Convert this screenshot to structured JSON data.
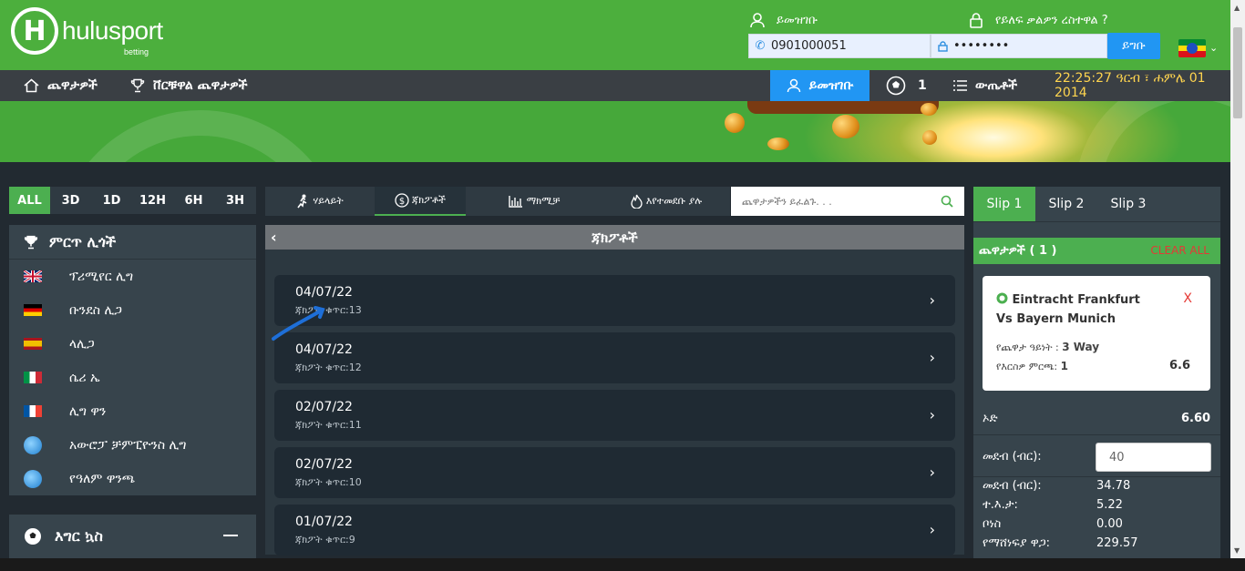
{
  "brand": {
    "logo_letter": "H",
    "name": "hulusport",
    "sub": "betting"
  },
  "header": {
    "register_link": "ይመዝገቡ",
    "forgot_link": "የይለፍ ቃልዎን ረስተዋል ?",
    "phone_value": "0901000051",
    "password_value": "••••••••",
    "login_button": "ይግቡ"
  },
  "nav": {
    "games": "ጨዋታዎች",
    "live_games": "ቨርቹዋል ጨዋታዎች",
    "register": "ይመዝገቡ",
    "ball_count": "1",
    "results": "ውጤቶች",
    "clock": "22:25:27 ዓርብ ፣ ሐምሌ 01 2014"
  },
  "time_filters": [
    "ALL",
    "3D",
    "1D",
    "12H",
    "6H",
    "3H"
  ],
  "leagues": {
    "title": "ምርጥ ሊጎች",
    "items": [
      {
        "name": "ፕሪሚየር ሊግ",
        "flag": "uk"
      },
      {
        "name": "ቡንደስ ሊጋ",
        "flag": "de"
      },
      {
        "name": "ላሊጋ",
        "flag": "es"
      },
      {
        "name": "ሴሪ ኤ",
        "flag": "it"
      },
      {
        "name": "ሊግ ዋን",
        "flag": "fr"
      },
      {
        "name": "አውሮፓ ቻምፒዮንስ ሊግ",
        "flag": "globe"
      },
      {
        "name": "የዓለም ዋንጫ",
        "flag": "globe"
      }
    ]
  },
  "sports": {
    "title": "እግር ኳስ"
  },
  "tabs": [
    "ሃይላይት",
    "ጃክፖቶች",
    "ማክሚቻ",
    "እየተመደቡ ያሉ"
  ],
  "search": {
    "placeholder": "ጨዋታዎችን ይፈልጉ. . ."
  },
  "jackpot": {
    "title": "ጃክፖቶች",
    "rows": [
      {
        "date": "04/07/22",
        "count": "ጃክፖት ቁጥር:13"
      },
      {
        "date": "04/07/22",
        "count": "ጃክፖት ቁጥር:12"
      },
      {
        "date": "02/07/22",
        "count": "ጃክፖት ቁጥር:11"
      },
      {
        "date": "02/07/22",
        "count": "ጃክፖት ቁጥር:10"
      },
      {
        "date": "01/07/22",
        "count": "ጃክፖት ቁጥር:9"
      }
    ]
  },
  "slip": {
    "tabs": [
      "Slip 1",
      "Slip 2",
      "Slip 3"
    ],
    "games_label": "ጨዋታዎች ( 1 )",
    "clear_all": "CLEAR ALL",
    "match": "Eintracht Frankfurt Vs Bayern Munich",
    "remove": "X",
    "market_label": "የጨዋታ ዓይነት :",
    "market_value": "3 Way",
    "pick_label": "የእርስዎ ምርጫ:",
    "pick_value": "1",
    "pick_odd": "6.6",
    "odd_label": "ኦድ",
    "odd_value": "6.60",
    "stake_label": "መደብ (ብር):",
    "stake_value": "40",
    "rows": [
      {
        "label": "መደብ (ብር):",
        "value": "34.78"
      },
      {
        "label": "ተ.እ.ታ:",
        "value": "5.22"
      },
      {
        "label": "ቦነስ",
        "value": "0.00"
      },
      {
        "label": "የማሸነፍያ ዋጋ:",
        "value": "229.57"
      }
    ]
  },
  "colors": {
    "brand_green": "#4caf3d",
    "nav_dark": "#3a3f44",
    "accent_blue": "#2196f3",
    "clock_yellow": "#ffd54f",
    "clear_red": "#e53935"
  }
}
